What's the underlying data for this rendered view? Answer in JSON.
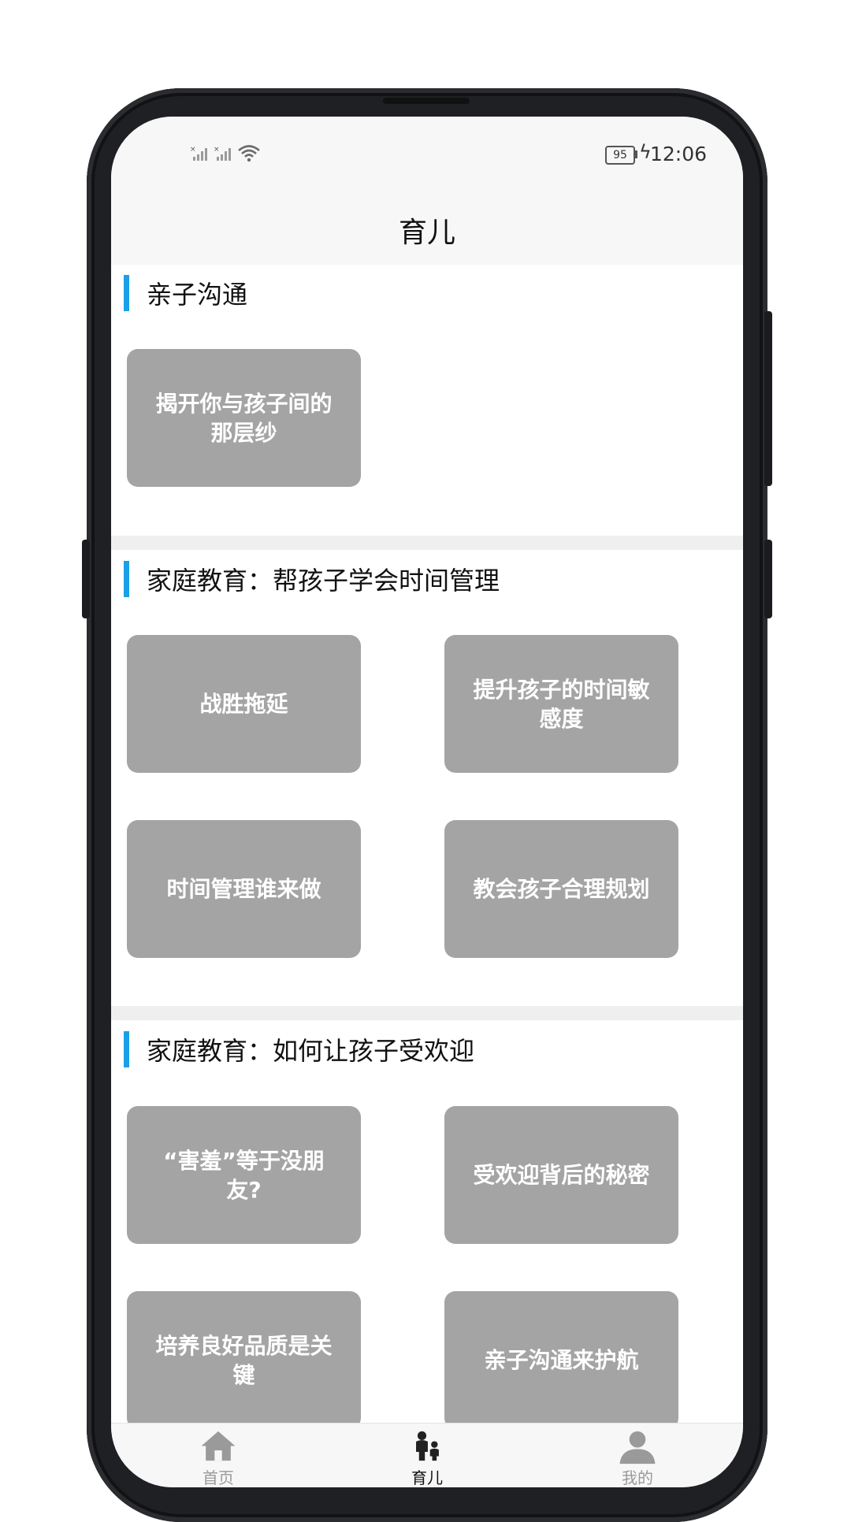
{
  "status_bar": {
    "battery": "95",
    "time": "12:06"
  },
  "header": {
    "title": "育儿"
  },
  "sections": [
    {
      "title": "亲子沟通",
      "cards": [
        "揭开你与孩子间的那层纱"
      ]
    },
    {
      "title": "家庭教育：帮孩子学会时间管理",
      "cards": [
        "战胜拖延",
        "提升孩子的时间敏感度",
        "时间管理谁来做",
        "教会孩子合理规划"
      ]
    },
    {
      "title": "家庭教育：如何让孩子受欢迎",
      "cards": [
        "“害羞”等于没朋友?",
        "受欢迎背后的秘密",
        "培养良好品质是关键",
        "亲子沟通来护航"
      ]
    }
  ],
  "tabbar": {
    "items": [
      {
        "label": "首页",
        "icon": "home-icon",
        "active": false
      },
      {
        "label": "育儿",
        "icon": "parent-child-icon",
        "active": true
      },
      {
        "label": "我的",
        "icon": "user-icon",
        "active": false
      }
    ],
    "active_color": "#111111",
    "inactive_color": "#9a9a9a"
  },
  "colors": {
    "accent": "#1aa0e6",
    "card_bg": "#a4a4a4"
  }
}
